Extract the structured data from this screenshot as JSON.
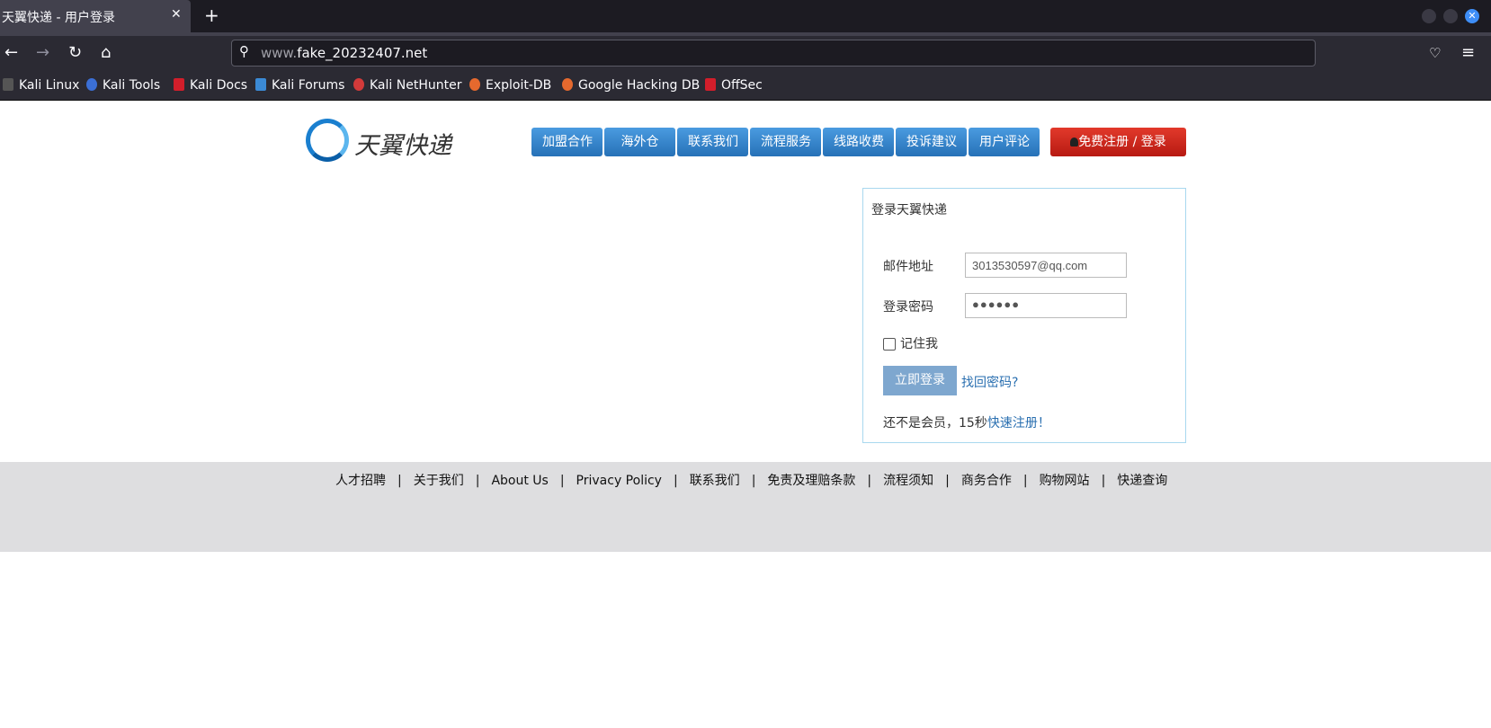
{
  "browser": {
    "tab_title": "天翼快递 - 用户登录",
    "tab_close": "✕",
    "new_tab": "+",
    "url_prefix": "www.",
    "url_domain": "fake_20232407.net",
    "bookmarks": [
      {
        "label": "Kali Linux",
        "color": "#555555"
      },
      {
        "label": "Kali Tools",
        "color": "#3b6fd6"
      },
      {
        "label": "Kali Docs",
        "color": "#d21e2b"
      },
      {
        "label": "Kali Forums",
        "color": "#3b8ad6"
      },
      {
        "label": "Kali NetHunter",
        "color": "#d23a3a"
      },
      {
        "label": "Exploit-DB",
        "color": "#e5692e"
      },
      {
        "label": "Google Hacking DB",
        "color": "#e5692e"
      },
      {
        "label": "OffSec",
        "color": "#d21e2b"
      }
    ]
  },
  "site": {
    "logo_text": "天翼快递",
    "nav": [
      "加盟合作",
      "海外仓",
      "联系我们",
      "流程服务",
      "线路收费",
      "投诉建议",
      "用户评论"
    ],
    "register_login": "免费注册 / 登录"
  },
  "login": {
    "title": "登录天翼快递",
    "email_label": "邮件地址",
    "email_value": "3013530597@qq.com",
    "password_label": "登录密码",
    "password_value": "●●●●●●",
    "remember_label": "记住我",
    "submit_label": "立即登录",
    "forgot_label": "找回密码?",
    "not_member_text": "还不是会员，15秒",
    "quick_register": "快速注册！"
  },
  "footer": {
    "links": [
      "人才招聘",
      "关于我们",
      "About Us",
      "Privacy Policy",
      "联系我们",
      "免责及理赔条款",
      "流程须知",
      "商务合作",
      "购物网站",
      "快递查询"
    ]
  }
}
